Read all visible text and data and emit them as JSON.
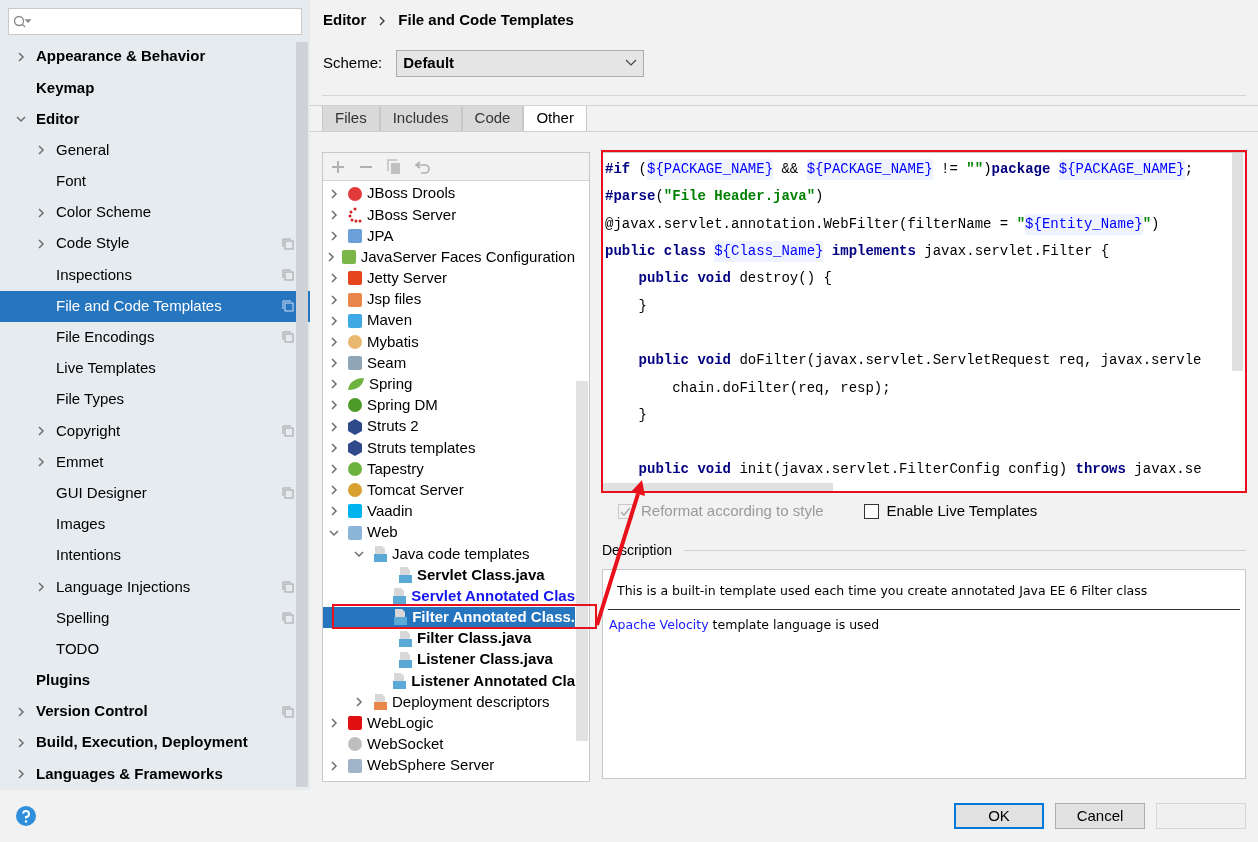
{
  "sidebar": {
    "items": [
      {
        "label": "Appearance & Behavior",
        "expanded": false,
        "selected": false
      },
      {
        "label": "Keymap",
        "selected": false
      },
      {
        "label": "Editor",
        "expanded": true,
        "selected": false,
        "children": [
          {
            "label": "General",
            "expanded": false,
            "selected": false
          },
          {
            "label": "Font",
            "selected": false
          },
          {
            "label": "Color Scheme",
            "expanded": false,
            "selected": false
          },
          {
            "label": "Code Style",
            "expanded": false,
            "selected": false,
            "project_level": true
          },
          {
            "label": "Inspections",
            "selected": false,
            "project_level": true
          },
          {
            "label": "File and Code Templates",
            "selected": true,
            "project_level": true
          },
          {
            "label": "File Encodings",
            "selected": false,
            "project_level": true
          },
          {
            "label": "Live Templates",
            "selected": false
          },
          {
            "label": "File Types",
            "selected": false
          },
          {
            "label": "Copyright",
            "expanded": false,
            "selected": false,
            "project_level": true
          },
          {
            "label": "Emmet",
            "expanded": false,
            "selected": false
          },
          {
            "label": "GUI Designer",
            "selected": false,
            "project_level": true
          },
          {
            "label": "Images",
            "selected": false
          },
          {
            "label": "Intentions",
            "selected": false
          },
          {
            "label": "Language Injections",
            "expanded": false,
            "selected": false,
            "project_level": true
          },
          {
            "label": "Spelling",
            "selected": false,
            "project_level": true
          },
          {
            "label": "TODO",
            "selected": false
          }
        ]
      },
      {
        "label": "Plugins",
        "selected": false
      },
      {
        "label": "Version Control",
        "expanded": false,
        "selected": false,
        "project_level": true
      },
      {
        "label": "Build, Execution, Deployment",
        "expanded": false,
        "selected": false
      },
      {
        "label": "Languages & Frameworks",
        "expanded": false,
        "selected": false
      }
    ]
  },
  "breadcrumb": [
    "Editor",
    "File and Code Templates"
  ],
  "scheme": {
    "label": "Scheme:",
    "value": "Default"
  },
  "tabs": [
    {
      "label": "Files",
      "selected": false
    },
    {
      "label": "Includes",
      "selected": false
    },
    {
      "label": "Code",
      "selected": false
    },
    {
      "label": "Other",
      "selected": true
    }
  ],
  "tree": {
    "items": [
      {
        "label": "JBoss Drools",
        "expanded": false,
        "selected": false
      },
      {
        "label": "JBoss Server",
        "expanded": false,
        "selected": false
      },
      {
        "label": "JPA",
        "expanded": false,
        "selected": false
      },
      {
        "label": "JavaServer Faces Configuration",
        "expanded": false,
        "selected": false
      },
      {
        "label": "Jetty Server",
        "expanded": false,
        "selected": false
      },
      {
        "label": "Jsp files",
        "expanded": false,
        "selected": false
      },
      {
        "label": "Maven",
        "expanded": false,
        "selected": false
      },
      {
        "label": "Mybatis",
        "expanded": false,
        "selected": false
      },
      {
        "label": "Seam",
        "expanded": false,
        "selected": false
      },
      {
        "label": "Spring",
        "expanded": false,
        "selected": false
      },
      {
        "label": "Spring DM",
        "expanded": false,
        "selected": false
      },
      {
        "label": "Struts 2",
        "expanded": false,
        "selected": false
      },
      {
        "label": "Struts templates",
        "expanded": false,
        "selected": false
      },
      {
        "label": "Tapestry",
        "expanded": false,
        "selected": false
      },
      {
        "label": "Tomcat Server",
        "expanded": false,
        "selected": false
      },
      {
        "label": "Vaadin",
        "expanded": false,
        "selected": false
      },
      {
        "label": "Web",
        "expanded": true,
        "selected": false,
        "children": [
          {
            "label": "Java code templates",
            "expanded": true,
            "selected": false,
            "children": [
              {
                "label": "Servlet Class.java",
                "kind": "template",
                "modified": false,
                "selected": false
              },
              {
                "label": "Servlet Annotated Clas",
                "kind": "template",
                "modified": true,
                "selected": false
              },
              {
                "label": "Filter Annotated Class.",
                "kind": "template",
                "modified": false,
                "selected": true
              },
              {
                "label": "Filter Class.java",
                "kind": "template",
                "modified": false,
                "selected": false
              },
              {
                "label": "Listener Class.java",
                "kind": "template",
                "modified": false,
                "selected": false
              },
              {
                "label": "Listener Annotated Cla",
                "kind": "template",
                "modified": false,
                "selected": false
              }
            ]
          },
          {
            "label": "Deployment descriptors",
            "expanded": false,
            "selected": false
          }
        ]
      },
      {
        "label": "WebLogic",
        "expanded": false,
        "selected": false
      },
      {
        "label": "WebSocket",
        "selected": false
      },
      {
        "label": "WebSphere Server",
        "expanded": false,
        "selected": false
      }
    ]
  },
  "code": [
    {
      "segments": [
        {
          "kind": "directive",
          "text": "#if"
        },
        {
          "kind": "plain",
          "text": " ("
        },
        {
          "kind": "var",
          "text": "${PACKAGE_NAME}"
        },
        {
          "kind": "plain",
          "text": " && "
        },
        {
          "kind": "var",
          "text": "${PACKAGE_NAME}"
        },
        {
          "kind": "plain",
          "text": " != "
        },
        {
          "kind": "string",
          "text": "\"\""
        },
        {
          "kind": "plain",
          "text": ")"
        },
        {
          "kind": "keyword",
          "text": "package "
        },
        {
          "kind": "var",
          "text": "${PACKAGE_NAME}"
        },
        {
          "kind": "plain",
          "text": ";"
        }
      ]
    },
    {
      "segments": [
        {
          "kind": "directive",
          "text": "#parse"
        },
        {
          "kind": "plain",
          "text": "("
        },
        {
          "kind": "string",
          "text": "\"File Header.java\""
        },
        {
          "kind": "plain",
          "text": ")"
        }
      ]
    },
    {
      "segments": [
        {
          "kind": "plain",
          "text": "@javax.servlet.annotation.WebFilter(filterName = "
        },
        {
          "kind": "string",
          "text": "\""
        },
        {
          "kind": "var",
          "text": "${Entity_Name}"
        },
        {
          "kind": "string",
          "text": "\""
        },
        {
          "kind": "plain",
          "text": ")"
        }
      ]
    },
    {
      "segments": [
        {
          "kind": "keyword",
          "text": "public class "
        },
        {
          "kind": "var",
          "text": "${Class_Name}"
        },
        {
          "kind": "keyword",
          "text": " implements"
        },
        {
          "kind": "plain",
          "text": " javax.servlet.Filter {"
        }
      ]
    },
    {
      "segments": [
        {
          "kind": "keyword",
          "text": "    public void"
        },
        {
          "kind": "plain",
          "text": " destroy() {"
        }
      ]
    },
    {
      "segments": [
        {
          "kind": "plain",
          "text": "    }"
        }
      ]
    },
    {
      "gap_before": true,
      "segments": [
        {
          "kind": "keyword",
          "text": "    public void"
        },
        {
          "kind": "plain",
          "text": " doFilter(javax.servlet.ServletRequest req, javax.servle"
        }
      ]
    },
    {
      "segments": [
        {
          "kind": "plain",
          "text": "        chain.doFilter(req, resp);"
        }
      ]
    },
    {
      "segments": [
        {
          "kind": "plain",
          "text": "    }"
        }
      ]
    },
    {
      "gap_before": true,
      "segments": [
        {
          "kind": "keyword",
          "text": "    public void"
        },
        {
          "kind": "plain",
          "text": " init(javax.servlet.FilterConfig config) "
        },
        {
          "kind": "keyword",
          "text": "throws"
        },
        {
          "kind": "plain",
          "text": " javax.se"
        }
      ]
    }
  ],
  "options": [
    {
      "label": "Reformat according to style",
      "checked": true,
      "disabled": true
    },
    {
      "label": "Enable Live Templates",
      "checked": false,
      "disabled": false
    }
  ],
  "description": {
    "title": "Description",
    "text": "This is a built-in template used each time you create annotated Java EE 6 Filter class",
    "link": "Apache Velocity",
    "link_rest": " template language is used"
  },
  "buttons": [
    {
      "label": "OK",
      "default": true,
      "disabled": false
    },
    {
      "label": "Cancel",
      "default": false,
      "disabled": false
    },
    {
      "default": false,
      "disabled": true
    }
  ]
}
